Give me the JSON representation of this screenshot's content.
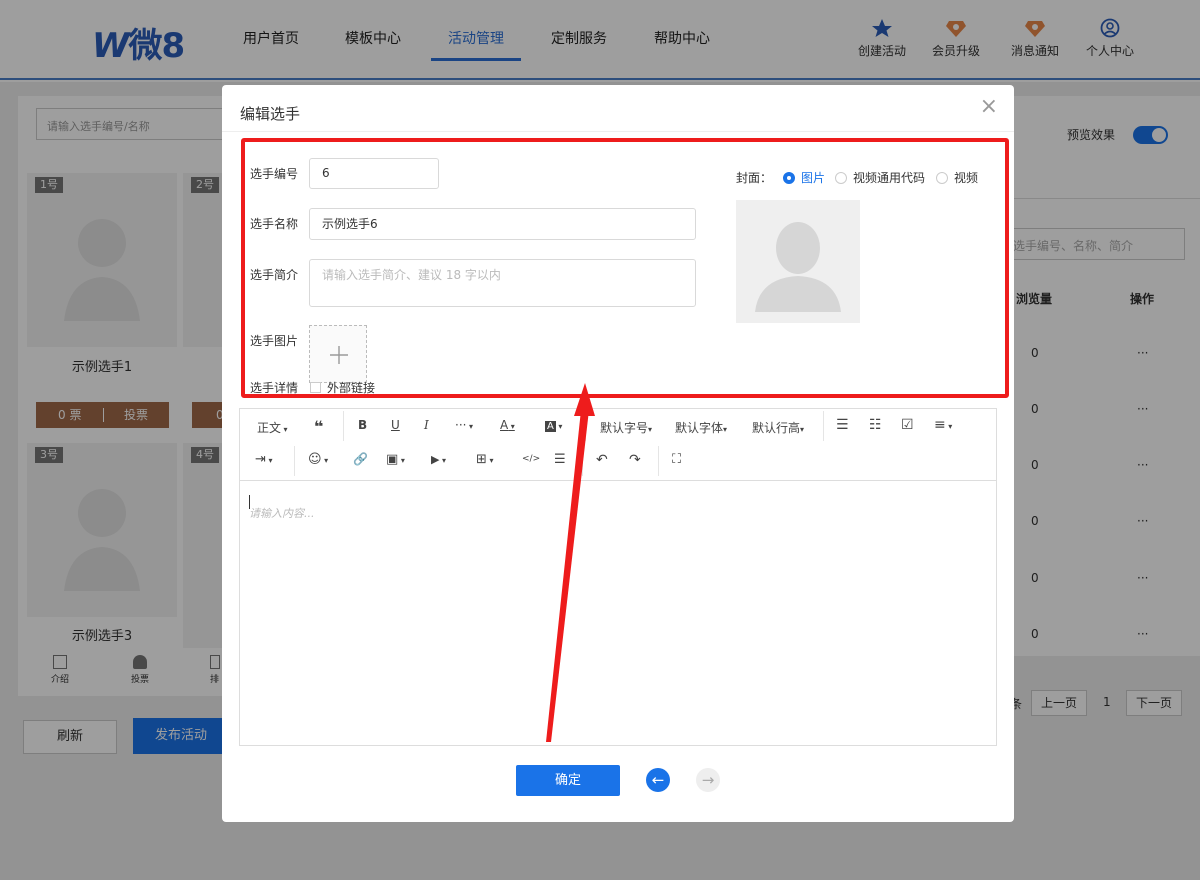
{
  "header": {
    "logo_w": "W",
    "logo_text": "微8",
    "nav": [
      "用户首页",
      "模板中心",
      "活动管理",
      "定制服务",
      "帮助中心"
    ],
    "tools": [
      "创建活动",
      "会员升级",
      "消息通知",
      "个人中心"
    ]
  },
  "background": {
    "search_placeholder": "请输入选手编号/名称",
    "cards": [
      {
        "num": "1号",
        "name": "示例选手1"
      },
      {
        "num": "2号",
        "name": ""
      },
      {
        "num": "3号",
        "name": "示例选手3"
      },
      {
        "num": "4号",
        "name": ""
      }
    ],
    "vote_count": "0 票",
    "vote_btn": "投票",
    "vote_partial": "0",
    "bottom_tabs": [
      "介绍",
      "投票",
      "排"
    ],
    "refresh": "刷新",
    "publish": "发布活动",
    "preview_label": "预览效果",
    "right_search": "选手编号、名称、简介",
    "col_views": "浏览量",
    "col_ops": "操作",
    "rows": [
      {
        "views": "0",
        "ops": "···"
      },
      {
        "views": "0",
        "ops": "···"
      },
      {
        "views": "0",
        "ops": "···"
      },
      {
        "views": "0",
        "ops": "···"
      },
      {
        "views": "0",
        "ops": "···"
      },
      {
        "views": "0",
        "ops": "···"
      }
    ],
    "pager": {
      "prefix": "条",
      "prev": "上一页",
      "page": "1",
      "next": "下一页"
    }
  },
  "modal": {
    "title": "编辑选手",
    "close": "×",
    "fields": {
      "number_label": "选手编号",
      "number_value": "6",
      "name_label": "选手名称",
      "name_value": "示例选手6",
      "intro_label": "选手简介",
      "intro_placeholder": "请输入选手简介、建议 18 字以内",
      "image_label": "选手图片",
      "detail_label": "选手详情",
      "external_link": "外部链接"
    },
    "cover": {
      "label": "封面：",
      "options": [
        "图片",
        "视频通用代码",
        "视频"
      ],
      "selected": "图片"
    },
    "toolbar_row1": [
      "正文",
      "❝",
      "B",
      "U",
      "I",
      "···",
      "A",
      "A",
      "默认字号",
      "默认字体",
      "默认行高",
      "☰",
      "☷",
      "☑",
      "≡"
    ],
    "toolbar_row2": [
      "⇥",
      "☺",
      "🔗",
      "▣",
      "▶",
      "⊞",
      "</>",
      "☰",
      "↶",
      "↷",
      "⛶"
    ],
    "editor_placeholder": "请输入内容...",
    "confirm": "确定",
    "back_icon": "←",
    "forward_icon": "→"
  },
  "colors": {
    "accent": "#1a73e8",
    "vote_bar": "#a1694a",
    "annotation_red": "#ee1c1c"
  }
}
